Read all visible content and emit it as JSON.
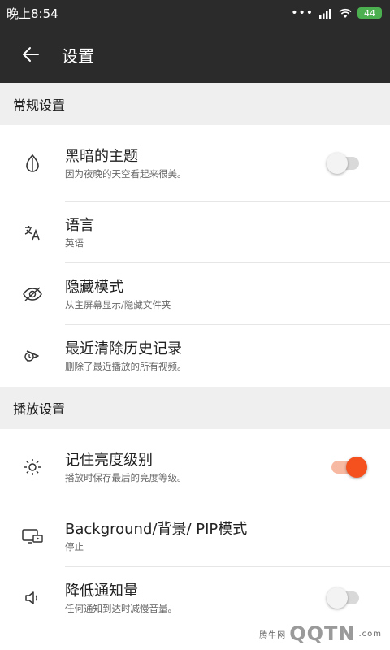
{
  "status_bar": {
    "time": "晚上8:54",
    "battery": "44"
  },
  "app_bar": {
    "title": "设置"
  },
  "sections": [
    {
      "header": "常规设置",
      "items": [
        {
          "title": "黑暗的主题",
          "subtitle": "因为夜晚的天空看起来很美。",
          "icon": "theme-drop-icon",
          "toggle": false
        },
        {
          "title": "语言",
          "subtitle": "英语",
          "icon": "translate-icon"
        },
        {
          "title": "隐藏模式",
          "subtitle": "从主屏幕显示/隐藏文件夹",
          "icon": "eye-off-icon"
        },
        {
          "title": "最近清除历史记录",
          "subtitle": "删除了最近播放的所有视频。",
          "icon": "history-clear-icon"
        }
      ]
    },
    {
      "header": "播放设置",
      "items": [
        {
          "title": "记住亮度级别",
          "subtitle": "播放时保存最后的亮度等级。",
          "icon": "brightness-icon",
          "toggle": true
        },
        {
          "title": "Background/背景/ PIP模式",
          "subtitle": "停止",
          "icon": "pip-icon"
        },
        {
          "title": "降低通知量",
          "subtitle": "任何通知到达时减慢音量。",
          "icon": "volume-low-icon",
          "toggle": false
        }
      ]
    }
  ],
  "watermark": {
    "brand": "QQTN",
    "domain": ".com",
    "cn": "腾牛网"
  },
  "colors": {
    "accent": "#f4511e",
    "bar": "#2b2b2b",
    "section_bg": "#efefef"
  }
}
